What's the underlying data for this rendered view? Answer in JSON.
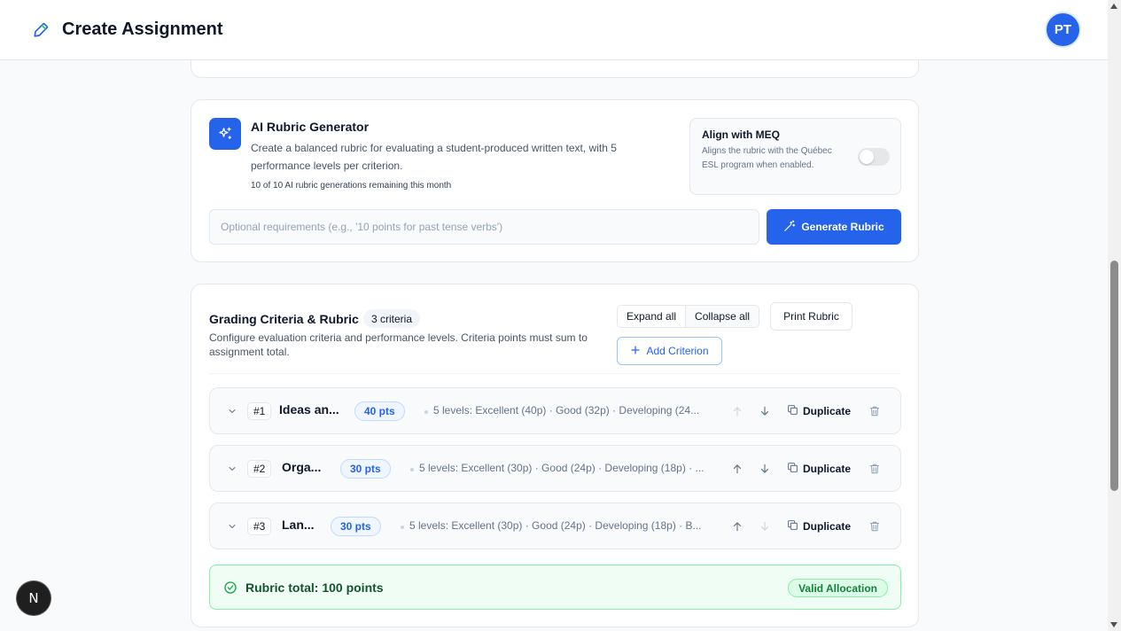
{
  "header": {
    "title": "Create Assignment",
    "avatar_initials": "PT",
    "logo_icon": "pencil-icon"
  },
  "colors": {
    "accent": "#2563eb",
    "success": "#15803d",
    "muted": "#64748b"
  },
  "ai_generator": {
    "title": "AI Rubric Generator",
    "description": "Create a balanced rubric for evaluating a student-produced written text, with 5 performance levels per criterion.",
    "remaining": "10 of 10 AI rubric generations remaining this month",
    "meq_title": "Align with MEQ",
    "meq_description": "Aligns the rubric with the Québec ESL program when enabled.",
    "meq_enabled": false,
    "requirements_placeholder": "Optional requirements (e.g., '10 points for past tense verbs')",
    "requirements_value": "",
    "generate_label": "Generate Rubric"
  },
  "grading": {
    "title": "Grading Criteria & Rubric",
    "count_badge": "3 criteria",
    "description": "Configure evaluation criteria and performance levels. Criteria points must sum to assignment total.",
    "expand_label": "Expand all",
    "collapse_label": "Collapse all",
    "print_label": "Print Rubric",
    "add_label": "Add Criterion",
    "duplicate_label": "Duplicate",
    "criteria": [
      {
        "num": "#1",
        "name": "Ideas an...",
        "points": "40 pts",
        "summary": "5 levels: Excellent (40p) · Good (32p) · Developing (24..."
      },
      {
        "num": "#2",
        "name": "Orga...",
        "points": "30 pts",
        "summary": "5 levels: Excellent (30p) · Good (24p) · Developing (18p) · ..."
      },
      {
        "num": "#3",
        "name": "Lan...",
        "points": "30 pts",
        "summary": "5 levels: Excellent (30p) · Good (24p) · Developing (18p) · B..."
      }
    ],
    "total_label": "Rubric total: 100 points",
    "valid_label": "Valid Allocation"
  },
  "floating": {
    "next_badge": "N"
  }
}
